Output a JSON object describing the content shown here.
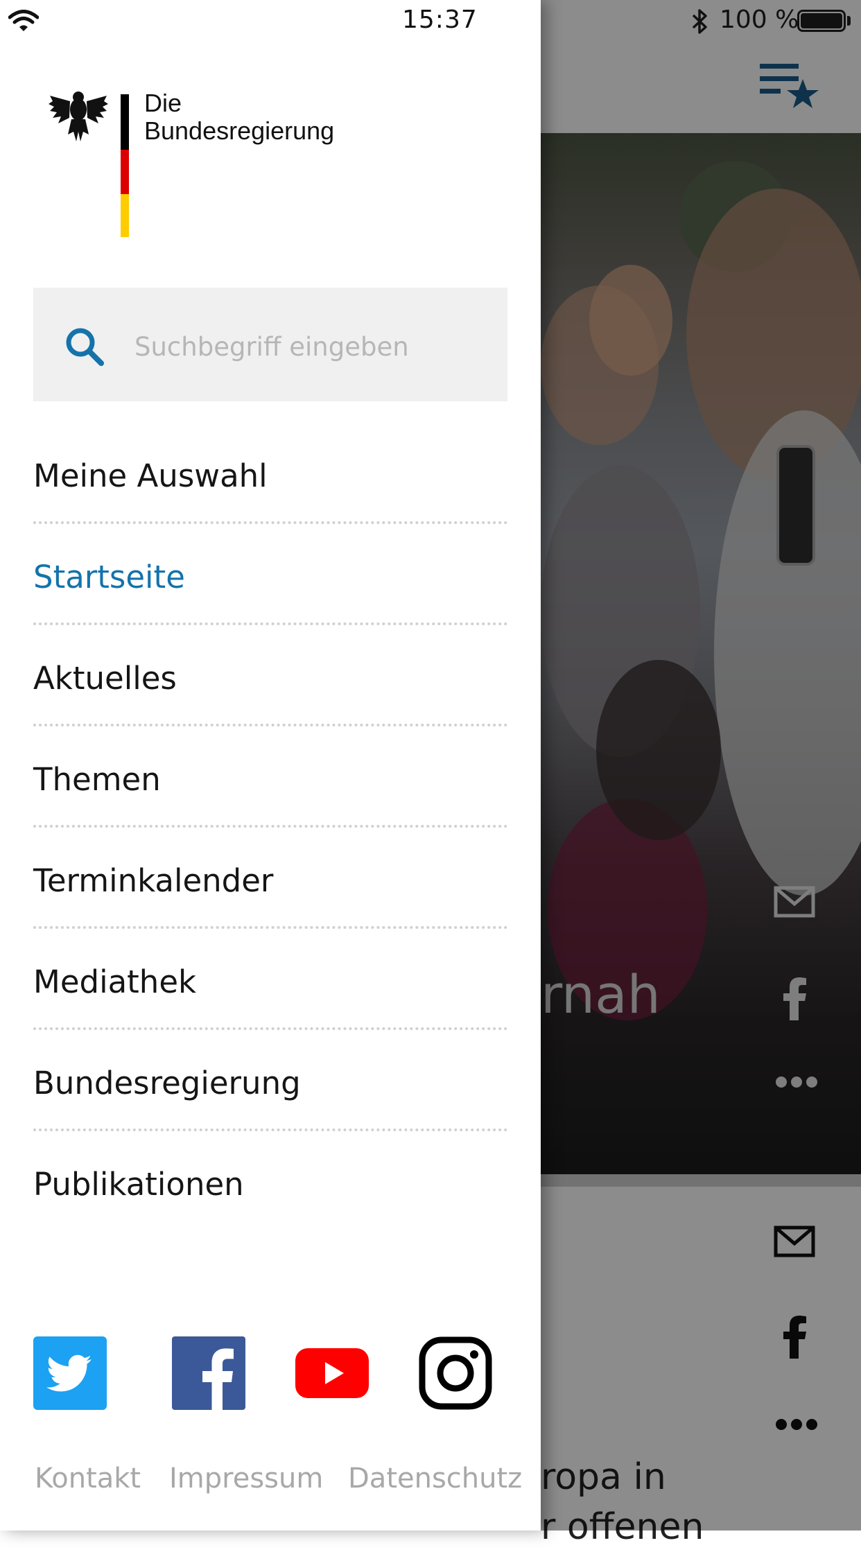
{
  "status_bar": {
    "time": "15:37",
    "battery_percent": "100 %",
    "icons": [
      "wifi-icon",
      "bluetooth-icon",
      "battery-icon"
    ]
  },
  "background_app": {
    "hero_title_fragment": "rnah",
    "teaser_text_line1": "ropa in",
    "teaser_text_line2": "r offenen",
    "icons": [
      "favorites-list-icon",
      "mail-icon",
      "facebook-icon",
      "more-icon"
    ]
  },
  "drawer": {
    "logo": {
      "line1": "Die",
      "line2": "Bundesregierung",
      "flag_colors": [
        "#000000",
        "#dd0000",
        "#ffcc00"
      ]
    },
    "search": {
      "placeholder": "Suchbegriff eingeben",
      "value": "",
      "icon": "search-icon"
    },
    "menu": {
      "items": [
        {
          "label": "Meine Auswahl",
          "active": false
        },
        {
          "label": "Startseite",
          "active": true
        },
        {
          "label": "Aktuelles",
          "active": false
        },
        {
          "label": "Themen",
          "active": false
        },
        {
          "label": "Terminkalender",
          "active": false
        },
        {
          "label": "Mediathek",
          "active": false
        },
        {
          "label": "Bundesregierung",
          "active": false
        },
        {
          "label": "Publikationen",
          "active": false
        }
      ]
    },
    "social": [
      {
        "name": "twitter-icon",
        "color": "#1da1f2"
      },
      {
        "name": "facebook-icon",
        "color": "#3b5998"
      },
      {
        "name": "youtube-icon",
        "color": "#ff0000"
      },
      {
        "name": "instagram-icon",
        "color": "#000000"
      }
    ],
    "footer": {
      "links": [
        "Kontakt",
        "Impressum",
        "Datenschutz"
      ]
    }
  },
  "colors": {
    "accent": "#1473ab",
    "menu_text": "#151515",
    "footer_text": "#a8a8a8",
    "search_bg": "#f0f0f0"
  }
}
